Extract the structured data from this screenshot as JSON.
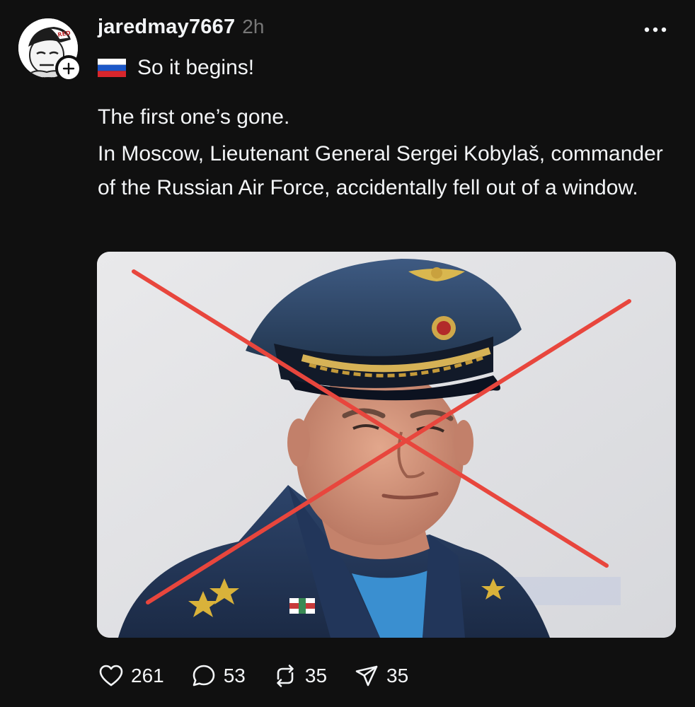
{
  "post": {
    "author": {
      "username": "jaredmay7667",
      "avatar_icon": "cartoon-avatar-icon",
      "follow_icon": "plus-icon"
    },
    "timestamp": "2h",
    "more_icon": "more-icon",
    "caption": {
      "flag_icon": "russia-flag-icon",
      "text": "So it begins!"
    },
    "body": {
      "line1": "The first one’s gone.",
      "line2": "In Moscow, Lieutenant General Sergei Kobylaš, commander of the Russian Air Force, accidentally fell out of a window."
    },
    "image": {
      "icon": "officer-photo-crossed-out"
    },
    "actions": {
      "likes": "261",
      "comments": "53",
      "reposts": "35",
      "shares": "35"
    }
  },
  "colors": {
    "background": "#101010",
    "text": "#f3f5f7",
    "muted": "#777777",
    "cross": "#e8463d"
  }
}
